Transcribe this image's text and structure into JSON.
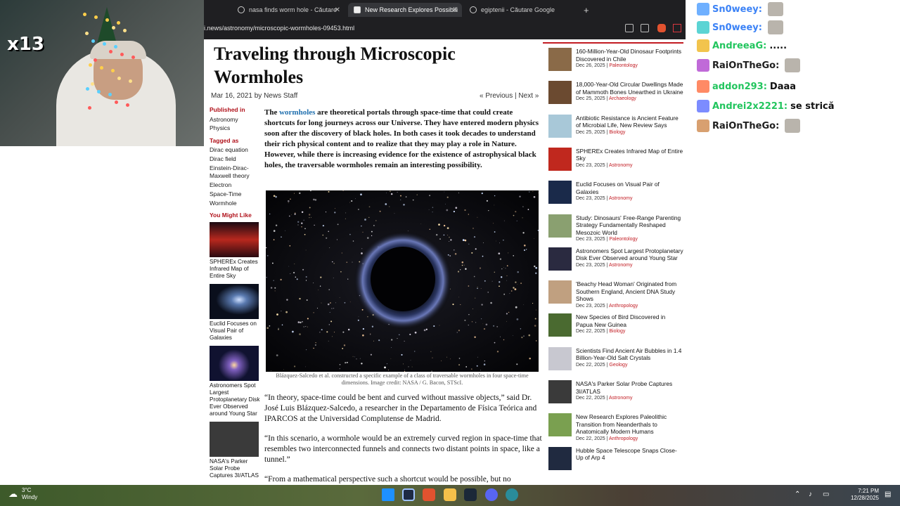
{
  "browser": {
    "tabs": [
      {
        "label": "nasa finds worm hole - Căutare"
      },
      {
        "label": "New Research Explores Possibili"
      },
      {
        "label": "egiptenii - Căutare Google"
      }
    ],
    "new_tab": "+",
    "address": "i.news/astronomy/microscopic-wormholes-09453.html"
  },
  "overlay": {
    "counter": "x13",
    "chat": [
      {
        "user": "Sn0weey:",
        "message": "",
        "color": "#3b82f6"
      },
      {
        "user": "Sn0weey:",
        "message": "",
        "color": "#3b82f6"
      },
      {
        "user": "AndreeaG:",
        "message": ".....",
        "color": "#22c55e"
      },
      {
        "user": "RaiOnTheGo:",
        "message": "",
        "color": "#1f1f1f"
      },
      {
        "user": "addon293:",
        "message": "Daaa",
        "color": "#22c55e"
      },
      {
        "user": "Andrei2x2221:",
        "message": "se strică",
        "color": "#22c55e"
      },
      {
        "user": "RaiOnTheGo:",
        "message": "",
        "color": "#1f1f1f"
      }
    ]
  },
  "article": {
    "title": "Traveling through Microscopic Wormholes",
    "date": "Mar 16, 2021",
    "by": "by",
    "author": "News Staff",
    "prev": "« Previous",
    "separator": "|",
    "next": "Next »",
    "published_in_heading": "Published in",
    "published_in": [
      "Astronomy",
      "Physics"
    ],
    "tagged_as_heading": "Tagged as",
    "tags": [
      "Dirac equation",
      "Dirac field",
      "Einstein-Dirac-Maxwell theory",
      "Electron",
      "Space-Time",
      "Wormhole"
    ],
    "you_might_like_heading": "You Might Like",
    "you_might_like": [
      {
        "caption": "SPHEREx Creates Infrared Map of Entire Sky"
      },
      {
        "caption": "Euclid Focuses on Visual Pair of Galaxies"
      },
      {
        "caption": "Astronomers Spot Largest Protoplanetary Disk Ever Observed around Young Star"
      },
      {
        "caption": "NASA's Parker Solar Probe Captures 3I/ATLAS"
      }
    ],
    "lead_the": "The",
    "lead_link": "wormholes",
    "lead_rest": "are theoretical portals through space-time that could create shortcuts for long journeys across our Universe. They have entered modern physics soon after the discovery of black holes. In both cases it took decades to understand their rich physical content and to realize that they may play a role in Nature. However, while there is increasing evidence for the existence of astrophysical black holes, the traversable wormholes remain an interesting possibility.",
    "figure_caption": "Blázquez-Salcedo et al. constructed a specific example of a class of traversable wormholes in four space-time dimensions. Image credit: NASA / G. Bacon, STScI.",
    "paragraphs": [
      "“In theory, space-time could be bent and curved without massive objects,” said Dr. José Luis Blázquez-Salcedo, a researcher in the Departamento de Física Teórica and IPARCOS at the Universidad Complutense de Madrid.",
      "“In this scenario, a wormhole would be an extremely curved region in space-time that resembles two interconnected funnels and connects two distant points in space, like a tunnel.”",
      "“From a mathematical perspective such a shortcut would be possible, but no"
    ]
  },
  "sidebar_news": [
    {
      "title": "160-Million-Year-Old Dinosaur Footprints Discovered in Chile",
      "date": "Dec 26, 2025",
      "category": "Paleontology"
    },
    {
      "title": "18,000-Year-Old Circular Dwellings Made of Mammoth Bones Unearthed in Ukraine",
      "date": "Dec 25, 2025",
      "category": "Archaeology"
    },
    {
      "title": "Antibiotic Resistance is Ancient Feature of Microbial Life, New Review Says",
      "date": "Dec 25, 2025",
      "category": "Biology"
    },
    {
      "title": "SPHEREx Creates Infrared Map of Entire Sky",
      "date": "Dec 23, 2025",
      "category": "Astronomy"
    },
    {
      "title": "Euclid Focuses on Visual Pair of Galaxies",
      "date": "Dec 23, 2025",
      "category": "Astronomy"
    },
    {
      "title": "Study: Dinosaurs' Free-Range Parenting Strategy Fundamentally Reshaped Mesozoic World",
      "date": "Dec 23, 2025",
      "category": "Paleontology"
    },
    {
      "title": "Astronomers Spot Largest Protoplanetary Disk Ever Observed around Young Star",
      "date": "Dec 23, 2025",
      "category": "Astronomy"
    },
    {
      "title": "'Beachy Head Woman' Originated from Southern England, Ancient DNA Study Shows",
      "date": "Dec 23, 2025",
      "category": "Anthropology"
    },
    {
      "title": "New Species of Bird Discovered in Papua New Guinea",
      "date": "Dec 22, 2025",
      "category": "Biology"
    },
    {
      "title": "Scientists Find Ancient Air Bubbles in 1.4 Billion-Year-Old Salt Crystals",
      "date": "Dec 22, 2025",
      "category": "Geology"
    },
    {
      "title": "NASA's Parker Solar Probe Captures 3I/ATLAS",
      "date": "Dec 22, 2025",
      "category": "Astronomy"
    },
    {
      "title": "New Research Explores Paleolithic Transition from Neanderthals to Anatomically Modern Humans",
      "date": "Dec 22, 2025",
      "category": "Anthropology"
    },
    {
      "title": "Hubble Space Telescope Snaps Close-Up of Arp 4",
      "date": "",
      "category": ""
    }
  ],
  "taskbar": {
    "temp": "3°C",
    "weather": "Windy",
    "time": "7:21 PM",
    "date": "12/28/2025"
  },
  "colors": {
    "accent_red": "#c21b22",
    "link_blue": "#1f6fae",
    "browser_dark": "#1f1f22"
  }
}
